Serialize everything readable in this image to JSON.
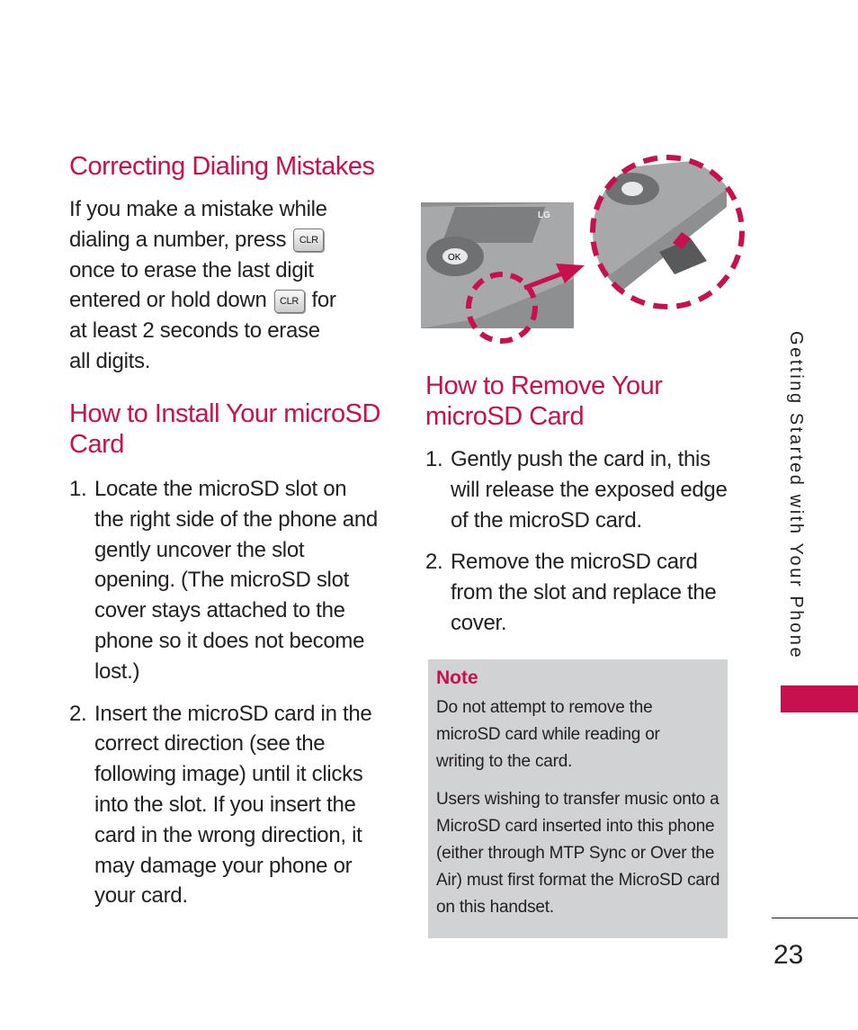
{
  "sections": {
    "correcting": {
      "title": "Correcting Dialing Mistakes",
      "text_a": "If you make a mistake while dialing a number, press",
      "key_label": "CLR",
      "text_b": "once to erase the last digit entered or hold down",
      "text_c": "for at least 2 seconds to erase all digits."
    },
    "install": {
      "title": "How to Install Your microSD Card",
      "steps": [
        {
          "num": "1.",
          "text": "Locate the microSD slot on the right side of the phone and gently uncover the slot opening. (The microSD slot cover stays attached to the phone so it does not become lost.)"
        },
        {
          "num": "2.",
          "text": "Insert the microSD card in the correct direction (see the following image) until it clicks into the slot. If you insert the card in the wrong direction, it may damage your phone or your card."
        }
      ]
    },
    "remove": {
      "title": "How to Remove Your microSD Card",
      "steps": [
        {
          "num": "1.",
          "text": "Gently push the card in, this will release the exposed edge of the microSD card."
        },
        {
          "num": "2.",
          "text": "Remove the microSD card from the slot and replace the cover."
        }
      ]
    }
  },
  "illustration": {
    "ok_label": "OK",
    "brand": "LG"
  },
  "note": {
    "title": "Note",
    "paragraphs": [
      "Do not attempt to remove the microSD card while reading or writing to the card.",
      "Users wishing to transfer music onto a MicroSD card inserted into this phone (either through MTP Sync or Over the Air) must first format the MicroSD card on this handset."
    ]
  },
  "sidebar": {
    "chapter": "Getting Started with Your Phone"
  },
  "page_number": "23",
  "colors": {
    "accent": "#c8104e",
    "note_bg": "#d1d2d4"
  }
}
